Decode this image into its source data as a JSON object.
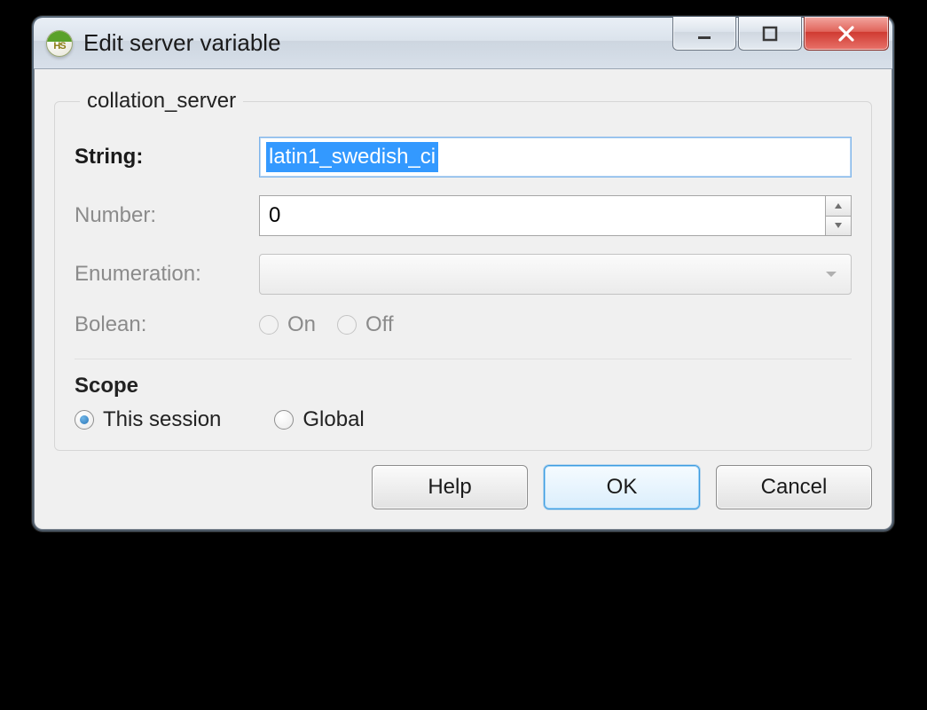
{
  "titlebar": {
    "title": "Edit server variable"
  },
  "group": {
    "legend": "collation_server",
    "fields": {
      "string": {
        "label": "String:",
        "value": "latin1_swedish_ci"
      },
      "number": {
        "label": "Number:",
        "value": "0"
      },
      "enumeration": {
        "label": "Enumeration:",
        "value": ""
      },
      "boolean": {
        "label": "Bolean:",
        "options": {
          "on": "On",
          "off": "Off"
        },
        "value": null
      }
    },
    "scope": {
      "label": "Scope",
      "options": {
        "session": "This session",
        "global": "Global"
      },
      "value": "session"
    }
  },
  "buttons": {
    "help": "Help",
    "ok": "OK",
    "cancel": "Cancel"
  }
}
